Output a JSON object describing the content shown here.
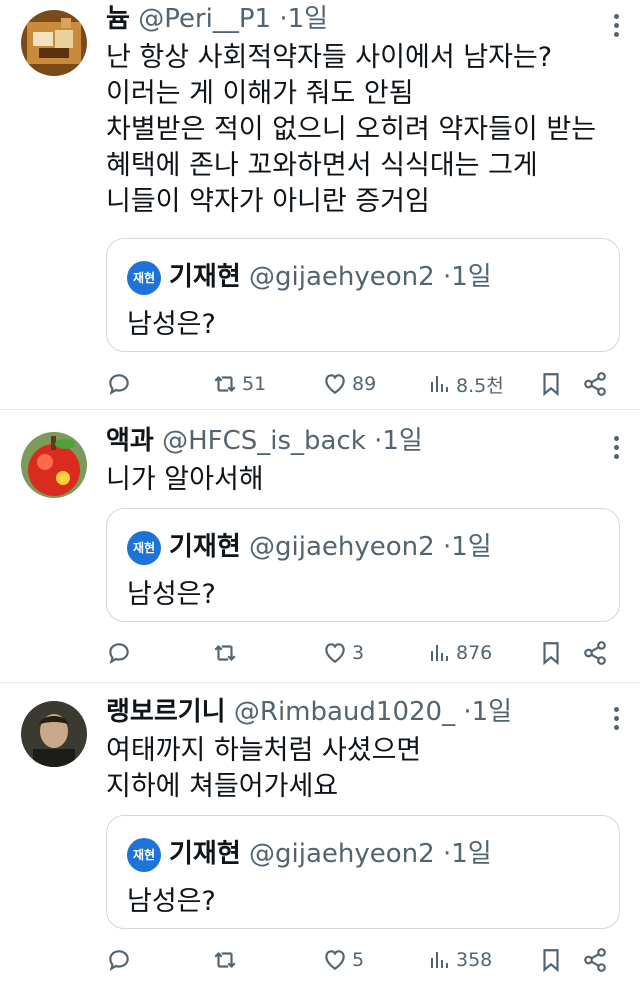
{
  "tweets": [
    {
      "name": "늄",
      "handle": "@Peri__P1",
      "dot": "·",
      "time": "1일",
      "lines": [
        "난 항상 사회적약자들 사이에서 남자는?",
        "이러는 게 이해가 줘도 안됨",
        "차별받은 적이 없으니 오히려 약자들이 받는",
        "혜택에 존나 꼬와하면서 식식대는 그게",
        "니들이 약자가 아니란 증거임"
      ],
      "quote": {
        "avatar_text": "재현",
        "name": "기재현",
        "handle": "@gijaehyeon2",
        "dot": "·",
        "time": "1일",
        "text": "남성은?"
      },
      "stats": {
        "retweets": "51",
        "likes": "89",
        "views": "8.5천"
      }
    },
    {
      "name": "액과",
      "handle": "@HFCS_is_back",
      "dot": "·",
      "time": "1일",
      "lines": [
        "니가 알아서해"
      ],
      "quote": {
        "avatar_text": "재현",
        "name": "기재현",
        "handle": "@gijaehyeon2",
        "dot": "·",
        "time": "1일",
        "text": "남성은?"
      },
      "stats": {
        "retweets": "",
        "likes": "3",
        "views": "876"
      }
    },
    {
      "name": "랭보르기니",
      "handle": "@Rimbaud1020_",
      "dot": "·",
      "time": "1일",
      "lines": [
        "여태까지 하늘처럼 사셨으면",
        "지하에 쳐들어가세요"
      ],
      "quote": {
        "avatar_text": "재현",
        "name": "기재현",
        "handle": "@gijaehyeon2",
        "dot": "·",
        "time": "1일",
        "text": "남성은?"
      },
      "stats": {
        "retweets": "",
        "likes": "5",
        "views": "358"
      }
    }
  ],
  "icons": [
    "reply-icon",
    "retweet-icon",
    "like-icon",
    "views-icon",
    "bookmark-icon",
    "share-icon",
    "more-icon"
  ],
  "colors": {
    "text": "#0f1419",
    "muted": "#536471",
    "border": "#cfd9de",
    "quote_avatar": "#1e73d8"
  }
}
